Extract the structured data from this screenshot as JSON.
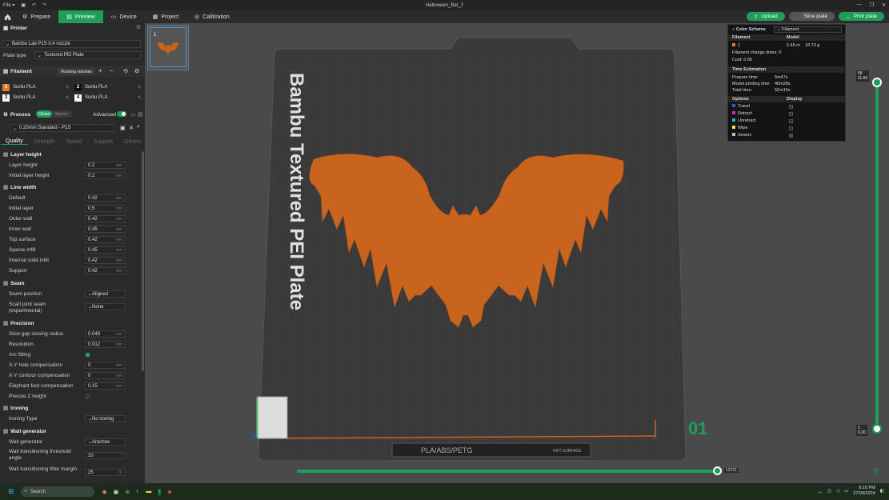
{
  "titlebar": {
    "file_menu": "File",
    "title": "Halloween_Bat_2"
  },
  "tabs": [
    {
      "label": "Prepare"
    },
    {
      "label": "Preview"
    },
    {
      "label": "Device"
    },
    {
      "label": "Project"
    },
    {
      "label": "Calibration"
    }
  ],
  "actions": {
    "upload": "Upload",
    "slice": "Slice plate",
    "print": "Print plate"
  },
  "printer": {
    "heading": "Printer",
    "model": "Bambu Lab P1S 0.4 nozzle",
    "plate_type_label": "Plate type",
    "plate_type": "Textured PEI Plate"
  },
  "filament": {
    "heading": "Filament",
    "flushing": "Flushing volumes",
    "slots": [
      {
        "num": "1",
        "name": "Sunlu PLA",
        "color": "#e07a2e"
      },
      {
        "num": "2",
        "name": "Sunlu PLA",
        "color": "#111111"
      },
      {
        "num": "3",
        "name": "Sunlu PLA",
        "color": "#ffffff"
      },
      {
        "num": "4",
        "name": "Sunlu PLA",
        "color": "#ffffff"
      }
    ]
  },
  "process": {
    "heading": "Process",
    "global": "Global",
    "objects": "Objects",
    "advanced": "Advanced",
    "preset": "0.20mm Standard - P1S",
    "subtabs": [
      "Quality",
      "Strength",
      "Speed",
      "Support",
      "Others"
    ]
  },
  "quality": {
    "layer_height": {
      "title": "Layer height",
      "items": [
        {
          "label": "Layer height",
          "value": "0.2",
          "unit": "mm"
        },
        {
          "label": "Initial layer height",
          "value": "0.2",
          "unit": "mm"
        }
      ]
    },
    "line_width": {
      "title": "Line width",
      "items": [
        {
          "label": "Default",
          "value": "0.42",
          "unit": "mm"
        },
        {
          "label": "Initial layer",
          "value": "0.5",
          "unit": "mm"
        },
        {
          "label": "Outer wall",
          "value": "0.42",
          "unit": "mm"
        },
        {
          "label": "Inner wall",
          "value": "0.45",
          "unit": "mm"
        },
        {
          "label": "Top surface",
          "value": "0.42",
          "unit": "mm"
        },
        {
          "label": "Sparse infill",
          "value": "0.45",
          "unit": "mm"
        },
        {
          "label": "Internal solid infill",
          "value": "0.42",
          "unit": "mm"
        },
        {
          "label": "Support",
          "value": "0.42",
          "unit": "mm"
        }
      ]
    },
    "seam": {
      "title": "Seam",
      "position_label": "Seam position",
      "position": "Aligned",
      "scarf_label": "Scarf joint seam (experimental)",
      "scarf": "None"
    },
    "precision": {
      "title": "Precision",
      "items": [
        {
          "label": "Slice gap closing radius",
          "value": "0.049",
          "unit": "mm"
        },
        {
          "label": "Resolution",
          "value": "0.012",
          "unit": "mm"
        }
      ],
      "arc_label": "Arc fitting",
      "items2": [
        {
          "label": "X-Y hole compensation",
          "value": "0",
          "unit": "mm"
        },
        {
          "label": "X-Y contour compensation",
          "value": "0",
          "unit": "mm"
        },
        {
          "label": "Elephant foot compensation",
          "value": "0.15",
          "unit": "mm"
        }
      ],
      "precise_z_label": "Precise Z height"
    },
    "ironing": {
      "title": "Ironing",
      "type_label": "Ironing Type",
      "type": "No ironing"
    },
    "wall_generator": {
      "title": "Wall generator",
      "gen_label": "Wall generator",
      "gen": "Arachne",
      "threshold_label": "Wall transitioning threshold angle",
      "threshold": "10",
      "threshold_unit": "°",
      "filter_label": "Wall transitioning filter margin",
      "filter": "25",
      "filter_unit": "%"
    }
  },
  "viewport": {
    "plate_label": "Bambu Textured PEI Plate",
    "plate_number": "01",
    "plate_footer": "PLA/ABS/PETG",
    "hot_surface": "HOT SURFACE",
    "thumb_number": "1",
    "layer_top": "58",
    "layer_top_mm": "11.60",
    "layer_bottom": "1",
    "layer_bottom_mm": "0.20",
    "move_value": "12291"
  },
  "info_panel": {
    "color_scheme_label": "Color Scheme",
    "color_scheme": "Filament",
    "col_filament": "Filament",
    "col_model": "Model",
    "row_num": "1",
    "row_len": "5.45 m",
    "row_weight": "18.73 g",
    "change_times_label": "Filament change times:",
    "change_times": "0",
    "cost_label": "Cost:",
    "cost": "0.66",
    "time_heading": "Time Estimation",
    "prepare_label": "Prepare time:",
    "prepare": "5m47s",
    "model_label": "Model printing time:",
    "model_time": "46m28s",
    "total_label": "Total time:",
    "total": "52m16s",
    "options_heading": "Options",
    "display_heading": "Display",
    "options": [
      {
        "label": "Travel",
        "color": "#3355cc"
      },
      {
        "label": "Retract",
        "color": "#cc3399"
      },
      {
        "label": "Unretract",
        "color": "#33aacc"
      },
      {
        "label": "Wipe",
        "color": "#eeee22"
      },
      {
        "label": "Seams",
        "color": "#bbbbbb"
      }
    ]
  },
  "taskbar": {
    "search": "Search",
    "time": "6:16 PM",
    "date": "27/09/2024"
  }
}
